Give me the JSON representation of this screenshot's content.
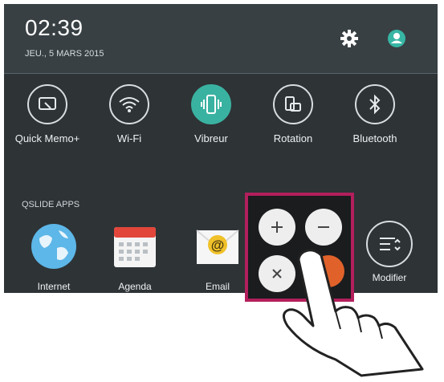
{
  "status": {
    "time": "02:39",
    "date": "JEU., 5 MARS 2015"
  },
  "icons": {
    "settings": "gear-icon",
    "profile": "user-icon"
  },
  "quick_settings": [
    {
      "label": "Quick Memo+",
      "icon": "quickmemo-icon",
      "active": false
    },
    {
      "label": "Wi-Fi",
      "icon": "wifi-icon",
      "active": false
    },
    {
      "label": "Vibreur",
      "icon": "vibrate-icon",
      "active": true
    },
    {
      "label": "Rotation",
      "icon": "rotation-icon",
      "active": false
    },
    {
      "label": "Bluetooth",
      "icon": "bluetooth-icon",
      "active": false
    }
  ],
  "qslide": {
    "title": "QSLIDE APPS",
    "apps": [
      {
        "label": "Internet",
        "icon": "globe-icon"
      },
      {
        "label": "Agenda",
        "icon": "calendar-icon"
      },
      {
        "label": "Email",
        "icon": "email-icon"
      },
      {
        "label": "Modifier",
        "icon": "edit-list-icon"
      }
    ]
  },
  "popup": {
    "buttons": [
      {
        "symbol": "+",
        "icon": "plus-icon"
      },
      {
        "symbol": "−",
        "icon": "minus-icon"
      },
      {
        "symbol": "×",
        "icon": "close-icon"
      }
    ]
  },
  "colors": {
    "panel": "#2e3336",
    "accent": "#3ab2a1",
    "highlight_border": "#b21f5c",
    "orange": "#e0622a"
  }
}
